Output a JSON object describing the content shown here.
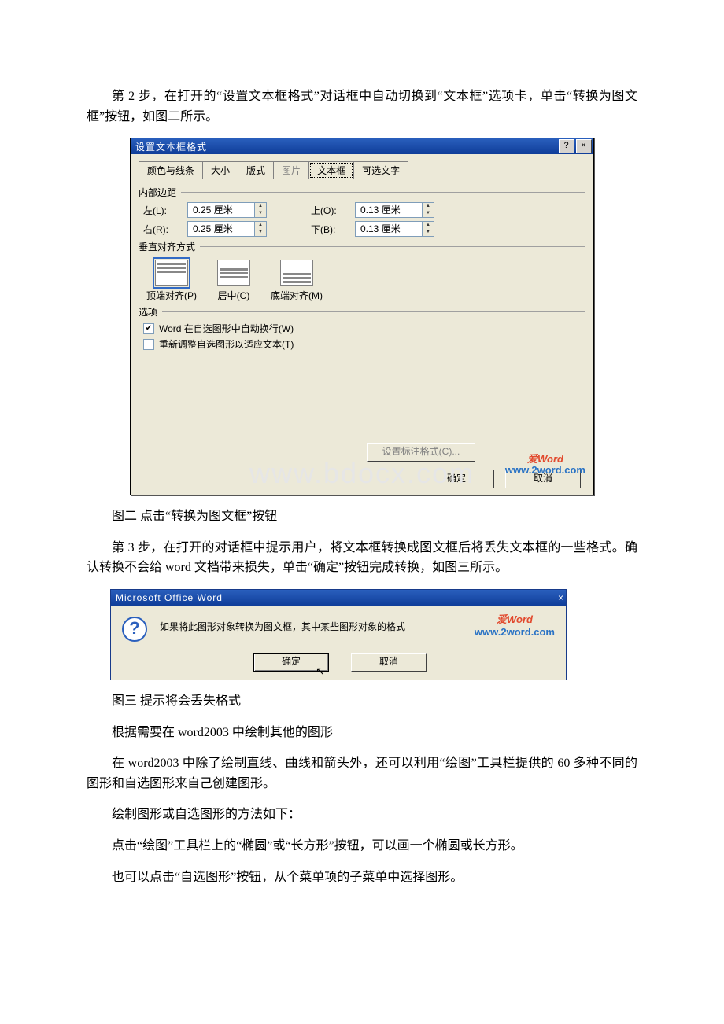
{
  "doc": {
    "p1": "第 2 步，在打开的“设置文本框格式”对话框中自动切换到“文本框”选项卡，单击“转换为图文框”按钮，如图二所示。",
    "caption1": "图二 点击“转换为图文框”按钮",
    "p2": "第 3 步，在打开的对话框中提示用户，将文本框转换成图文框后将丢失文本框的一些格式。确认转换不会给 word 文档带来损失，单击“确定”按钮完成转换，如图三所示。",
    "caption2": "图三 提示将会丢失格式",
    "p3": "根据需要在 word2003 中绘制其他的图形",
    "p4": "在 word2003 中除了绘制直线、曲线和箭头外，还可以利用“绘图”工具栏提供的 60 多种不同的图形和自选图形来自己创建图形。",
    "p5": "绘制图形或自选图形的方法如下：",
    "p6": "点击“绘图”工具栏上的“椭圆”或“长方形”按钮，可以画一个椭圆或长方形。",
    "p7": "也可以点击“自选图形”按钮，从个菜单项的子菜单中选择图形。"
  },
  "dlg1": {
    "title": "设置文本框格式",
    "help_glyph": "?",
    "close_glyph": "×",
    "tabs": {
      "t1": "颜色与线条",
      "t2": "大小",
      "t3": "版式",
      "t4": "图片",
      "t5": "文本框",
      "t6": "可选文字"
    },
    "group_margin": "内部边距",
    "left_label": "左(L):",
    "left_value": "0.25 厘米",
    "right_label": "右(R):",
    "right_value": "0.25 厘米",
    "top_label": "上(O):",
    "top_value": "0.13 厘米",
    "bottom_label": "下(B):",
    "bottom_value": "0.13 厘米",
    "group_valign": "垂直对齐方式",
    "valign_top": "顶端对齐(P)",
    "valign_mid": "居中(C)",
    "valign_bot": "底端对齐(M)",
    "group_opts": "选项",
    "opt_wrap": "Word 在自选图形中自动换行(W)",
    "opt_resize": "重新调整自选图形以适应文本(T)",
    "callout_btn": "设置标注格式(C)...",
    "ok": "确定",
    "cancel": "取消",
    "bgwm": "www.bdocx.com"
  },
  "dlg2": {
    "title": "Microsoft Office Word",
    "close_glyph": "×",
    "question_glyph": "?",
    "msg": "如果将此图形对象转换为图文框，其中某些图形对象的格式",
    "ok": "确定",
    "cancel": "取消"
  },
  "wm": {
    "ai": "爱",
    "word": "Word",
    "url": "www.2word.com"
  }
}
